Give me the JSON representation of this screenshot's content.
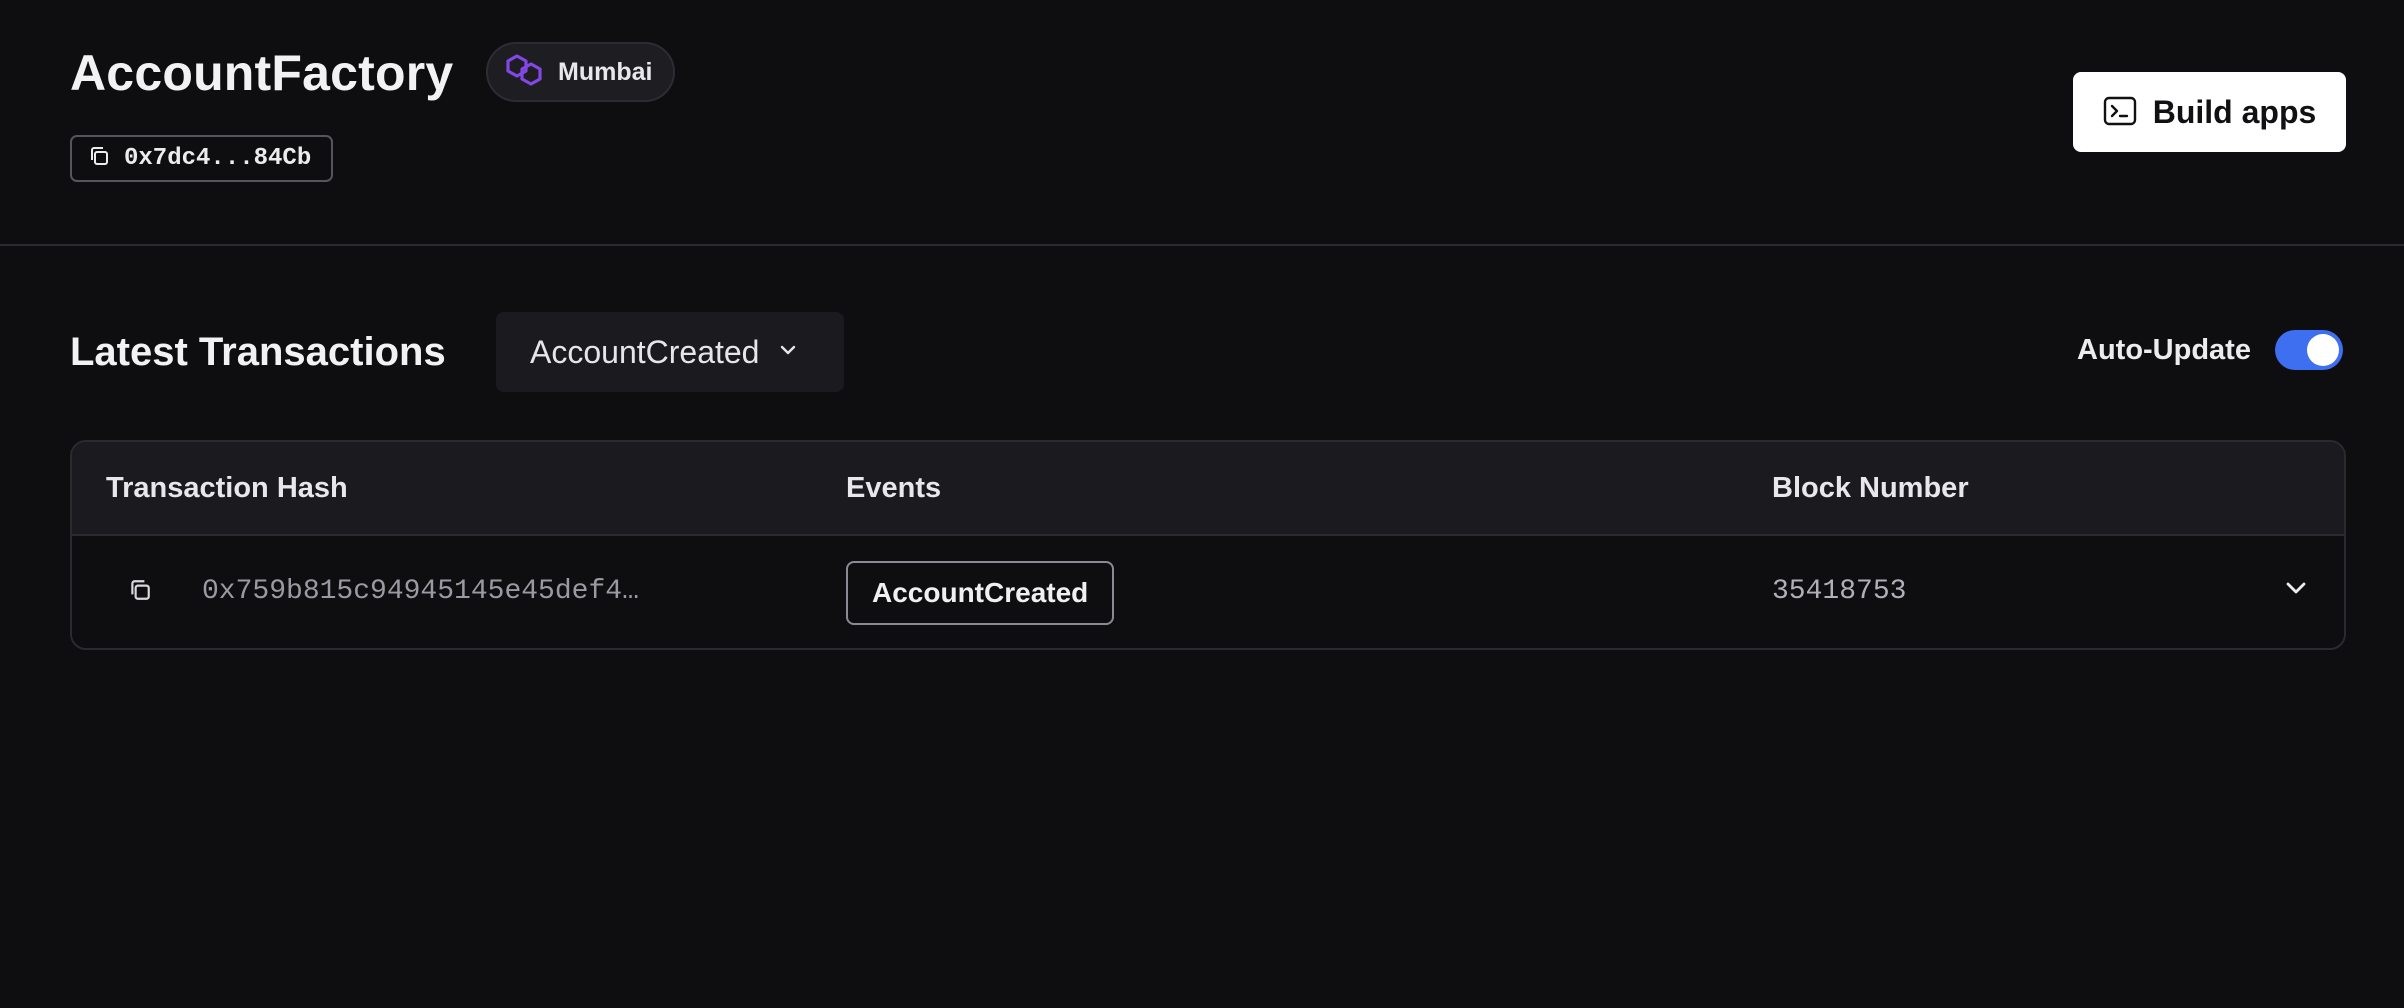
{
  "header": {
    "title": "AccountFactory",
    "chain": {
      "label": "Mumbai",
      "icon": "polygon-logo-icon",
      "accent": "#8247e5"
    },
    "address": "0x7dc4...84Cb",
    "build_button_label": "Build apps"
  },
  "transactions": {
    "title": "Latest Transactions",
    "event_filter": {
      "selected": "AccountCreated"
    },
    "auto_update": {
      "label": "Auto-Update",
      "enabled": true,
      "accent": "#3e6ff0"
    },
    "columns": [
      "Transaction Hash",
      "Events",
      "Block Number"
    ],
    "rows": [
      {
        "hash": "0x759b815c94945145e45def4…",
        "event": "AccountCreated",
        "block": "35418753"
      }
    ]
  }
}
